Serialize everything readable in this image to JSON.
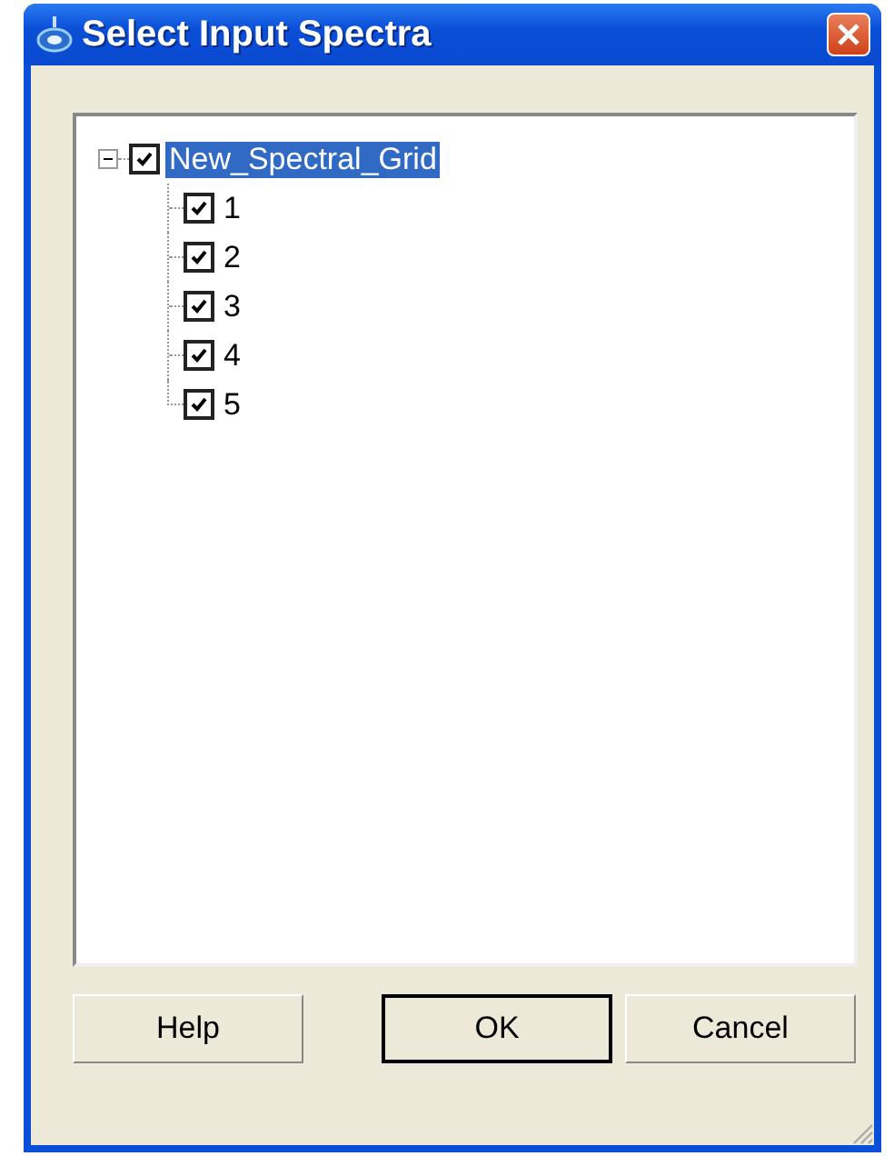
{
  "window": {
    "title": "Select Input Spectra"
  },
  "tree": {
    "items": [
      {
        "label": "New_Spectral_Grid",
        "expanded": true,
        "checked": true,
        "selected": true,
        "children": [
          {
            "label": "1",
            "checked": true,
            "selected": false
          },
          {
            "label": "2",
            "checked": true,
            "selected": false
          },
          {
            "label": "3",
            "checked": true,
            "selected": false
          },
          {
            "label": "4",
            "checked": true,
            "selected": false
          },
          {
            "label": "5",
            "checked": true,
            "selected": false
          }
        ]
      }
    ]
  },
  "buttons": [
    {
      "label": "Help",
      "default": false
    },
    {
      "label": "OK",
      "default": true
    },
    {
      "label": "Cancel",
      "default": false
    }
  ]
}
